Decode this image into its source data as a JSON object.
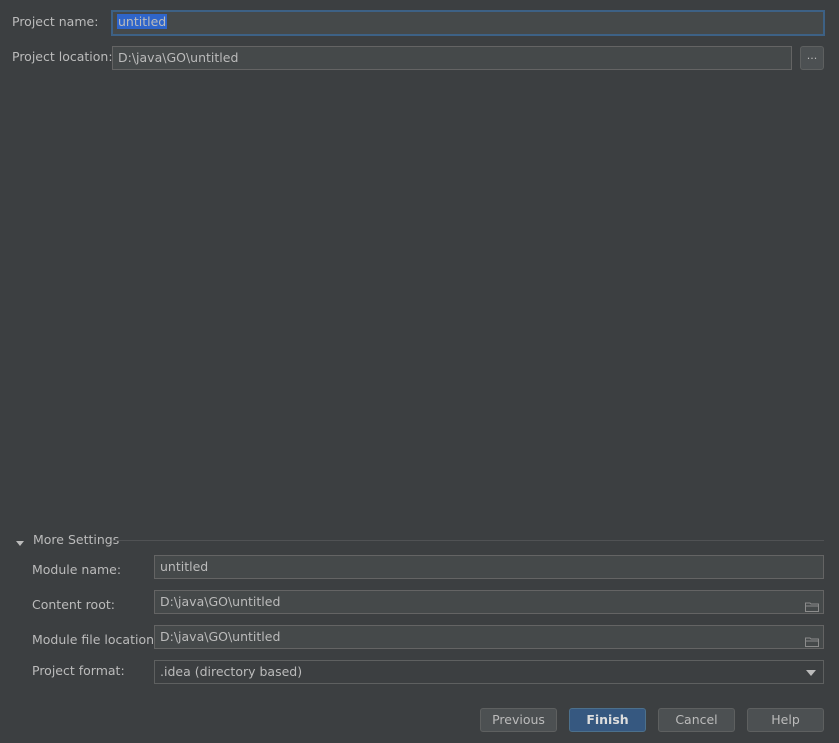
{
  "project": {
    "name_label": "Project name:",
    "name_value": "untitled",
    "location_label": "Project location:",
    "location_value": "D:\\java\\GO\\untitled",
    "browse_label": "..."
  },
  "more_settings": {
    "title": "More Settings",
    "expanded": true,
    "module_name_label": "Module name:",
    "module_name_value": "untitled",
    "content_root_label": "Content root:",
    "content_root_value": "D:\\java\\GO\\untitled",
    "module_file_location_label": "Module file location:",
    "module_file_location_value": "D:\\java\\GO\\untitled",
    "project_format_label": "Project format:",
    "project_format_value": ".idea (directory based)"
  },
  "buttons": {
    "previous": "Previous",
    "finish": "Finish",
    "cancel": "Cancel",
    "help": "Help"
  },
  "icons": {
    "expand": "triangle-down-icon",
    "folder": "folder-icon",
    "dropdown": "chevron-down-icon"
  },
  "colors": {
    "background": "#3c3f41",
    "field_background": "#45494a",
    "focus_border": "#3d6185",
    "selection": "#2f65ca",
    "primary_button": "#365880",
    "text": "#bbbbbb"
  }
}
